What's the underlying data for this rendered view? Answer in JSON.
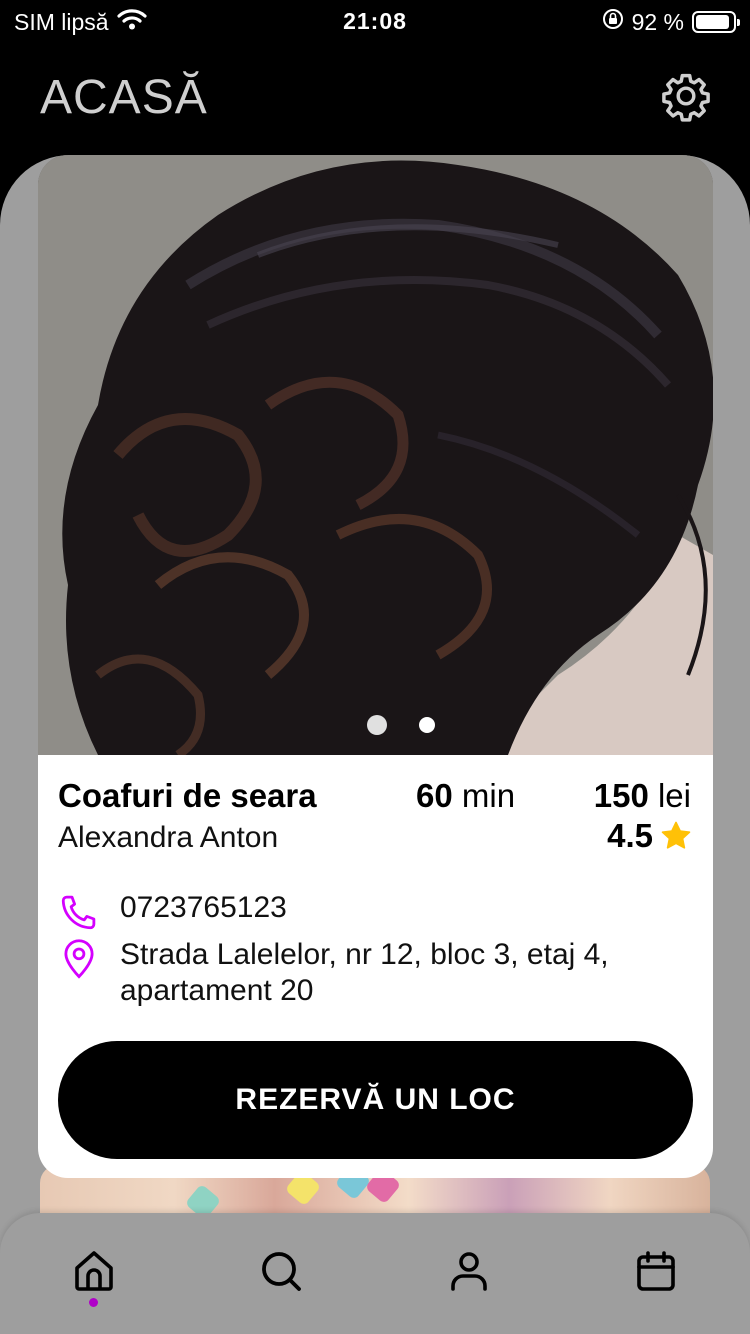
{
  "status_bar": {
    "carrier": "SIM lipsă",
    "time": "21:08",
    "battery_percent": "92 %",
    "battery_level": 0.92
  },
  "header": {
    "title": "ACASĂ",
    "settings_icon": "gear-icon"
  },
  "service_card": {
    "image_page_count": 2,
    "active_image_index": 0,
    "service_name": "Coafuri de seara",
    "duration_value": "60",
    "duration_unit": "min",
    "price_value": "150",
    "price_unit": "lei",
    "stylist": "Alexandra Anton",
    "rating": "4.5",
    "phone": "0723765123",
    "address": "Strada Lalelelor, nr 12, bloc 3, etaj 4, apartament 20",
    "book_label": "REZERVĂ UN LOC",
    "accent_color": "#d400ff",
    "star_color": "#ffc107"
  },
  "tab_bar": {
    "tabs": [
      {
        "icon": "home-icon",
        "active": true
      },
      {
        "icon": "search-icon",
        "active": false
      },
      {
        "icon": "user-icon",
        "active": false
      },
      {
        "icon": "calendar-icon",
        "active": false
      }
    ],
    "active_color": "#b000c8"
  }
}
